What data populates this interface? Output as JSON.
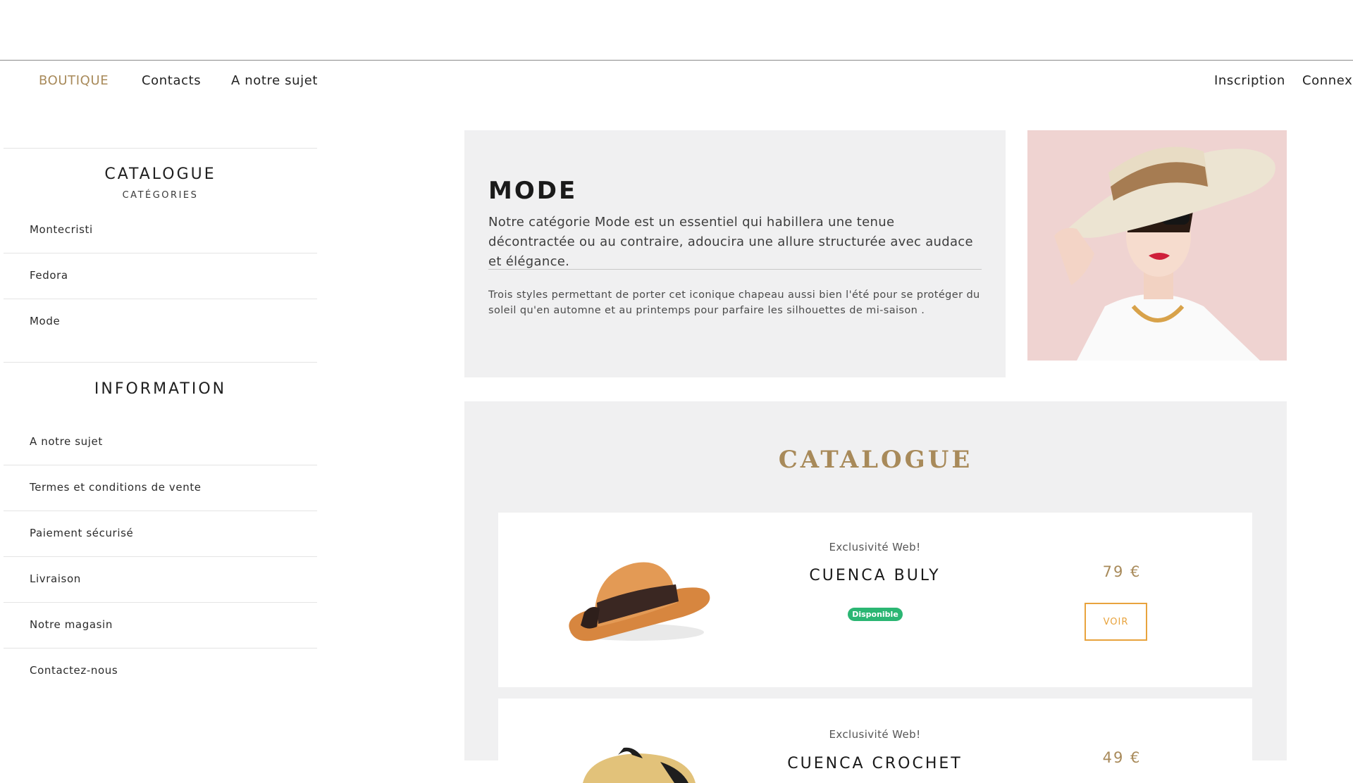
{
  "nav": {
    "left": [
      {
        "label": "BOUTIQUE",
        "active": true
      },
      {
        "label": "Contacts",
        "active": false
      },
      {
        "label": "A notre sujet",
        "active": false
      }
    ],
    "right": [
      {
        "label": "Inscription"
      },
      {
        "label": "Connexi"
      }
    ]
  },
  "sidebar": {
    "catalogue_heading": "CATALOGUE",
    "catalogue_sub": "CATÉGORIES",
    "categories": [
      "Montecristi",
      "Fedora",
      "Mode"
    ],
    "information_heading": "INFORMATION",
    "information_items": [
      "A notre sujet",
      "Termes et conditions de vente",
      "Paiement sécurisé",
      "Livraison",
      "Notre magasin",
      "Contactez-nous"
    ]
  },
  "category": {
    "title": "MODE",
    "description": "Notre catégorie Mode est un essentiel qui habillera une tenue décontractée ou au contraire, adoucira une allure structurée avec audace et élégance.",
    "note": "Trois styles permettant de porter cet iconique chapeau aussi bien l'été pour se protéger du soleil qu'en automne et au printemps pour parfaire les silhouettes de mi-saison ."
  },
  "catalogue": {
    "title": "CATALOGUE",
    "products": [
      {
        "tag": "Exclusivité Web!",
        "name": "CUENCA BULY",
        "badge": "Disponible",
        "price": "79 €",
        "button": "VOIR",
        "image": "straw-hat-black-ribbon"
      },
      {
        "tag": "Exclusivité Web!",
        "name": "CUENCA CROCHET",
        "price": "49 €",
        "image": "natural-straw-hat"
      }
    ]
  },
  "colors": {
    "accent_gold": "#a88a5a",
    "button_orange": "#e8a33d",
    "badge_green": "#2bb673",
    "panel_gray": "#f0f0f1"
  }
}
